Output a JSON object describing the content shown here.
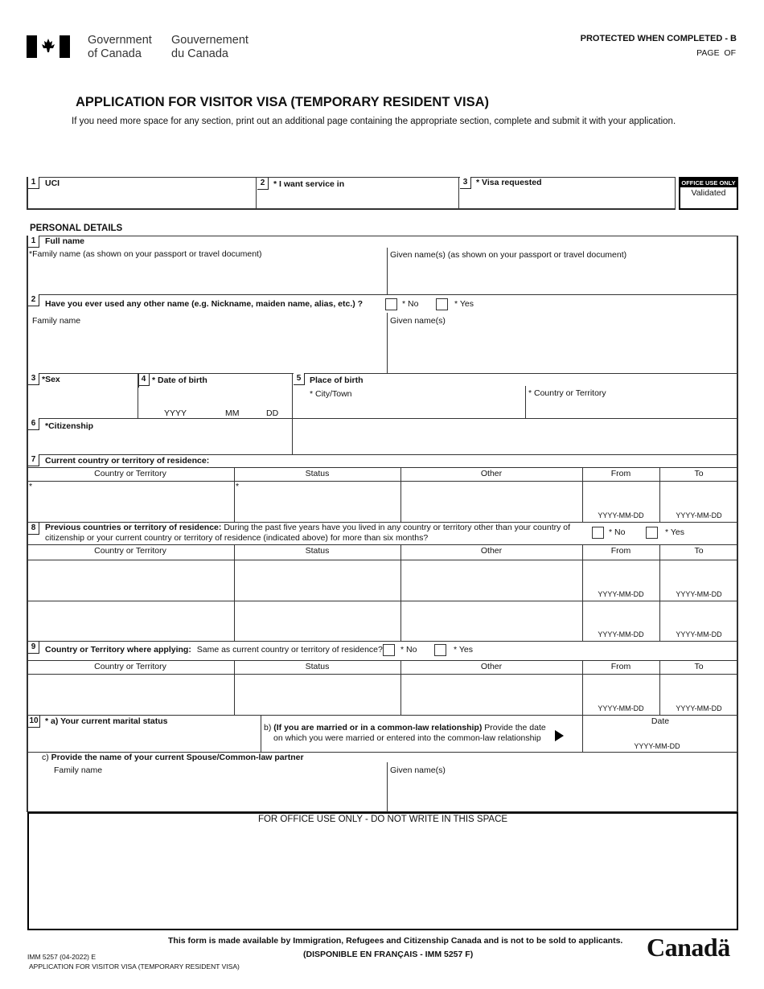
{
  "header": {
    "gov_en_line1": "Government",
    "gov_en_line2": "of Canada",
    "gov_fr_line1": "Gouvernement",
    "gov_fr_line2": "du Canada",
    "protected": "PROTECTED WHEN COMPLETED - B",
    "page_of": "PAGE  OF"
  },
  "title": "APPLICATION FOR VISITOR VISA (TEMPORARY RESIDENT VISA)",
  "instructions": "If you need more space for any section, print out an additional page containing the appropriate section, complete and submit it with your application.",
  "top_fields": [
    {
      "num": "1",
      "label": "UCI"
    },
    {
      "num": "2",
      "label": "* I want service in"
    },
    {
      "num": "3",
      "label": "* Visa requested"
    }
  ],
  "office_use": {
    "header": "OFFICE USE ONLY",
    "label": "Validated"
  },
  "personal_details": {
    "heading": "PERSONAL DETAILS",
    "q1": {
      "num": "1",
      "label": "Full name",
      "family": "*Family name  (as shown on your passport or travel document)",
      "given": "Given name(s)  (as shown on your passport or travel document)"
    },
    "q2": {
      "num": "2",
      "label": "Have you ever used any other name (e.g. Nickname, maiden name, alias, etc.) ?",
      "no": "* No",
      "yes": "* Yes",
      "family": "Family name",
      "given": "Given name(s)"
    },
    "q3": {
      "num": "3",
      "label": "*Sex"
    },
    "q4": {
      "num": "4",
      "label": "* Date of birth",
      "yyyy": "YYYY",
      "mm": "MM",
      "dd": "DD"
    },
    "q5": {
      "num": "5",
      "label": "Place of birth",
      "city": "* City/Town",
      "country": "* Country or Territory"
    },
    "q6": {
      "num": "6",
      "label": "*Citizenship"
    },
    "q7": {
      "num": "7",
      "label": "Current country or territory of residence:"
    },
    "q8": {
      "num": "8",
      "label_bold": "Previous countries or territory of residence:",
      "label_rest": " During the past five years have you lived in any country or territory other than your country of",
      "label_line2": "citizenship or your current country or territory of residence (indicated above) for more than six months?",
      "no": "* No",
      "yes": "* Yes"
    },
    "q9": {
      "num": "9",
      "label_bold": "Country or Territory where applying:",
      "label_rest": "Same as current country or territory of residence?",
      "no": "* No",
      "yes": "* Yes"
    },
    "q10": {
      "num": "10",
      "label_a": "* a) Your current marital status",
      "label_b_prefix": "b) ",
      "label_b_bold": "(If you are married or in a common-law relationship)",
      "label_b_rest": " Provide the date",
      "label_b_line2": "on which you were married or entered into the common-law relationship",
      "date": "Date",
      "date_fmt": "YYYY-MM-DD",
      "label_c_prefix": "c) ",
      "label_c": "Provide the name of your current Spouse/Common-law partner",
      "family": "Family name",
      "given": "Given name(s)"
    },
    "columns": [
      "Country or Territory",
      "Status",
      "Other",
      "From",
      "To"
    ],
    "date_fmt": "YYYY-MM-DD",
    "required_mark": "*"
  },
  "office_space": "FOR OFFICE USE ONLY - DO NOT WRITE IN THIS SPACE",
  "footer": {
    "notice": "This form is made available by Immigration, Refugees and Citizenship Canada and is not to be sold to applicants.",
    "french": "(DISPONIBLE EN FRANÇAIS - IMM 5257 F)",
    "form_id": "IMM 5257 (04-2022) E",
    "form_title": "APPLICATION FOR VISITOR VISA (TEMPORARY RESIDENT VISA)",
    "wordmark": "Canadä"
  }
}
